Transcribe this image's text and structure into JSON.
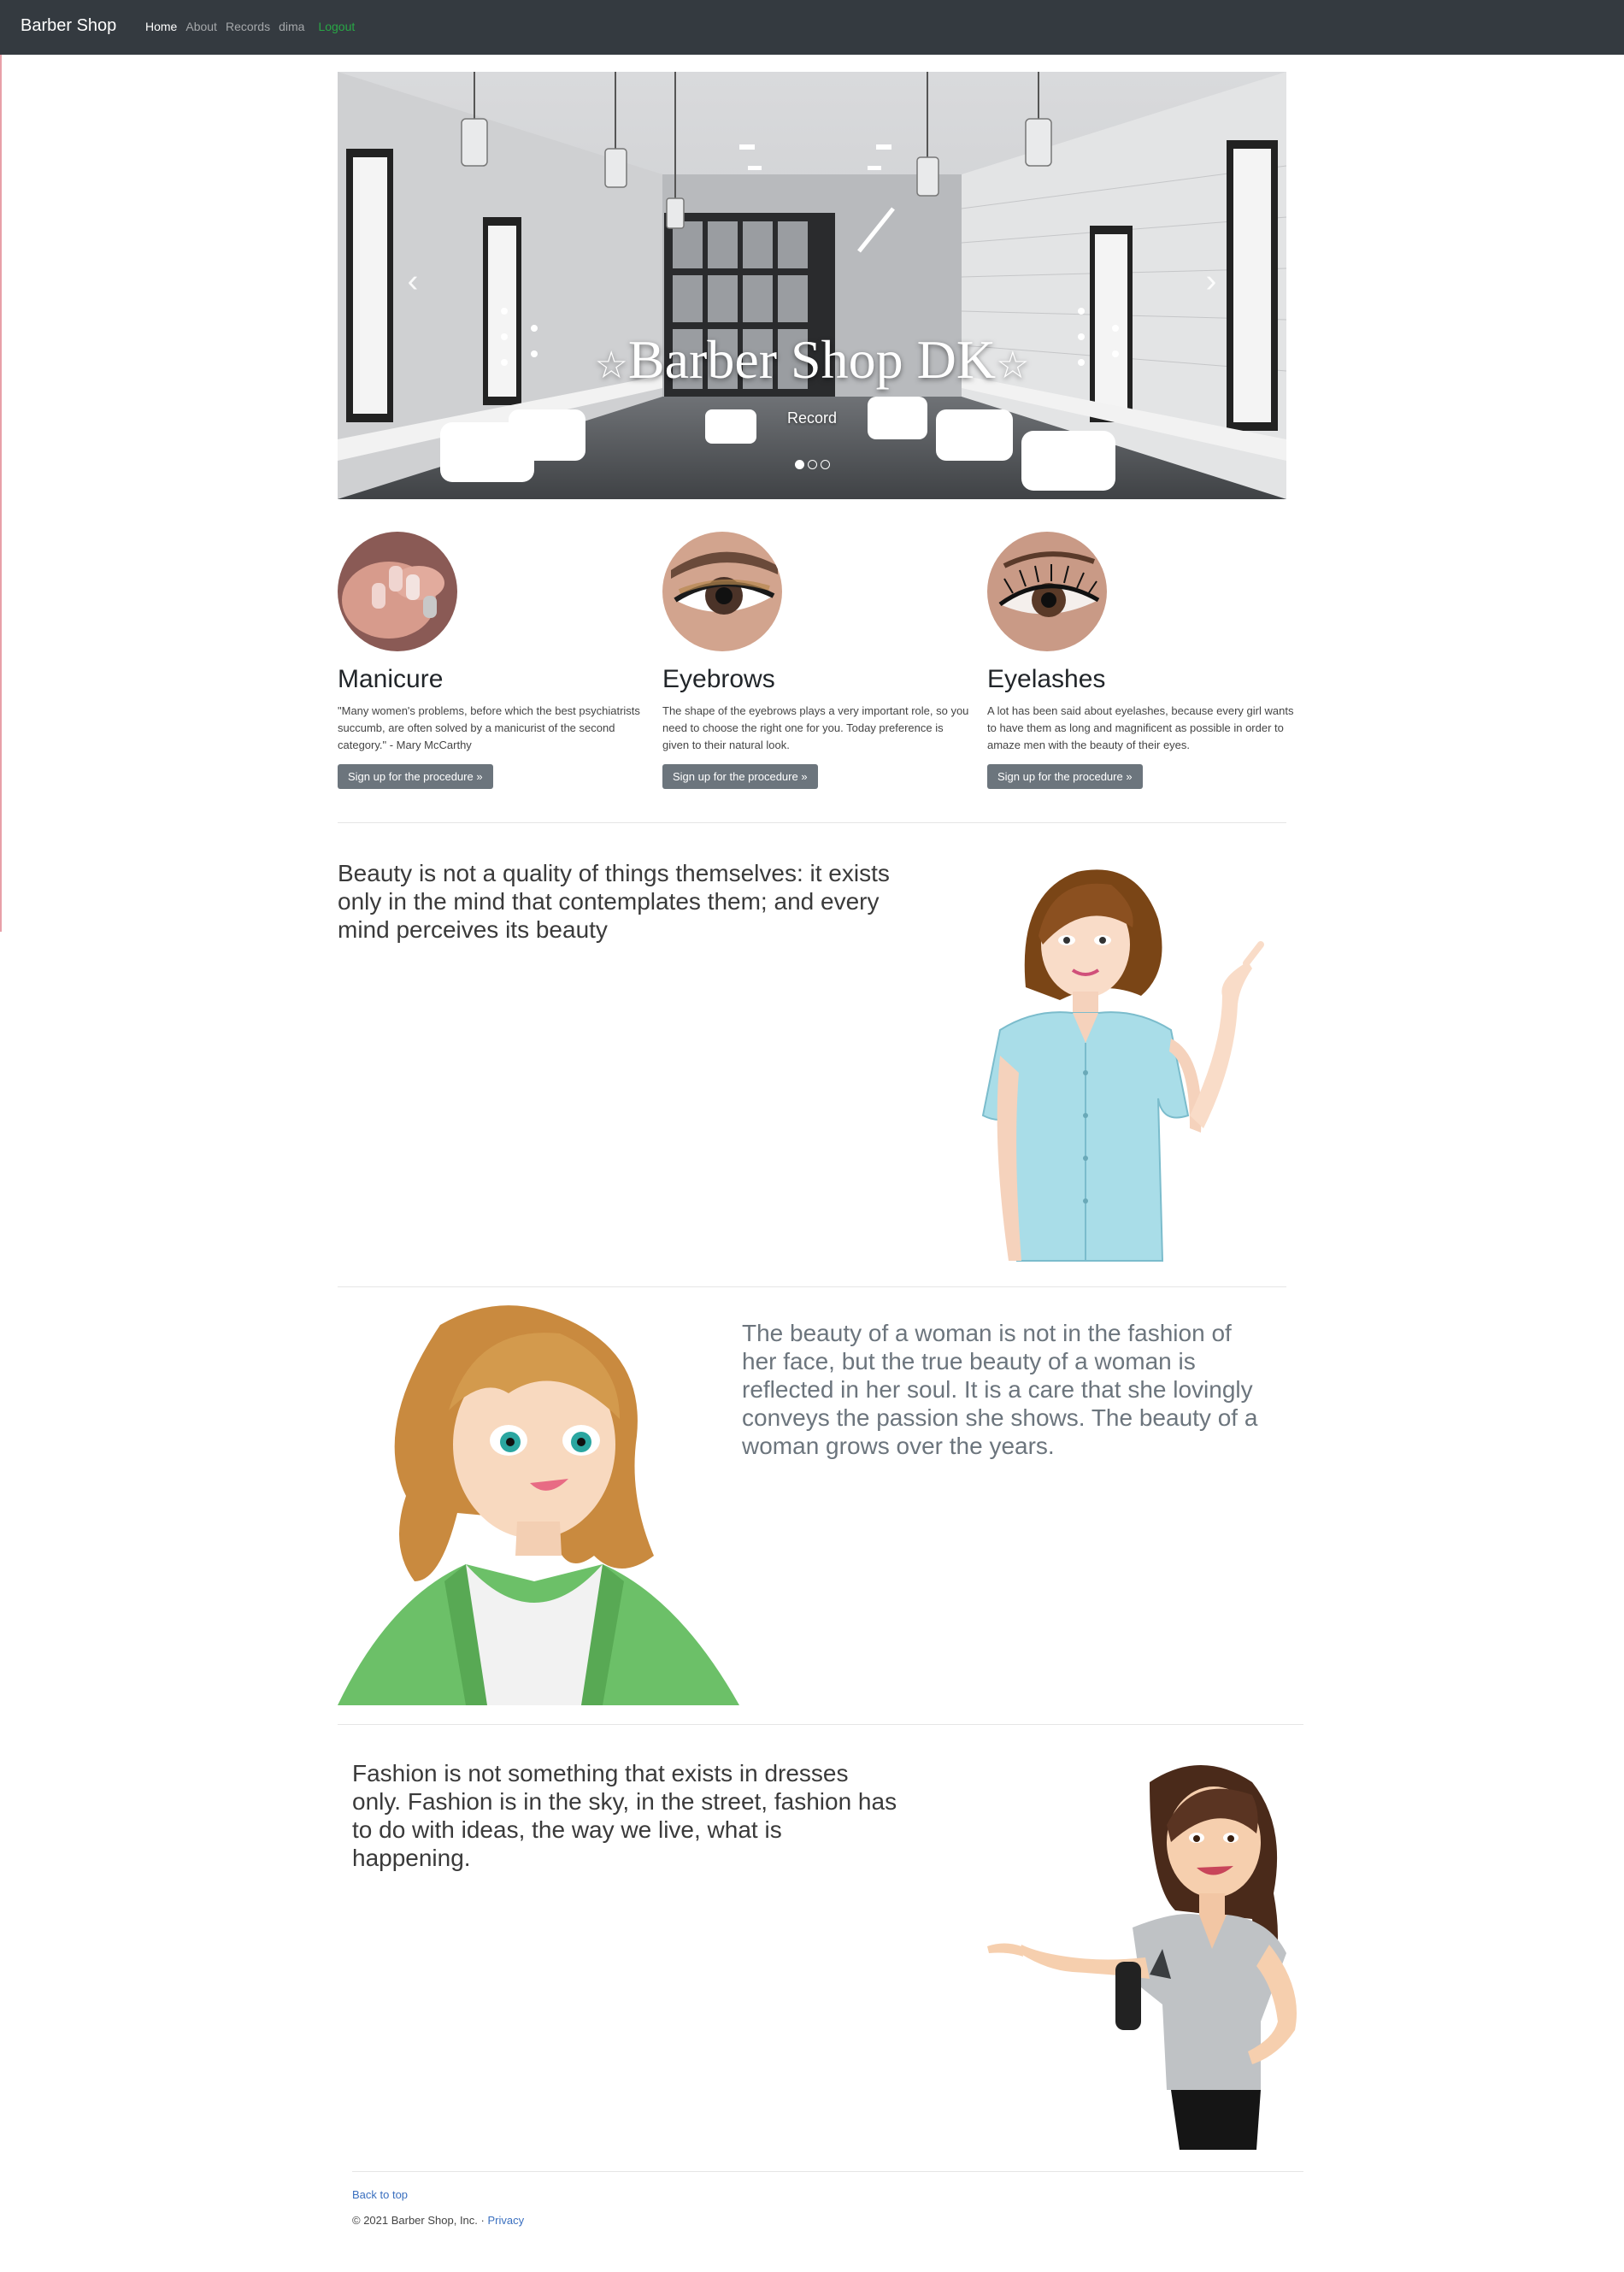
{
  "navbar": {
    "brand": "Barber Shop",
    "links": [
      "Home",
      "About",
      "Records",
      "dima"
    ],
    "logout": "Logout"
  },
  "carousel": {
    "title": "Barber Shop DK",
    "star": "☆",
    "record": "Record",
    "prev_icon": "chevron-left-icon",
    "next_icon": "chevron-right-icon",
    "slides": 3,
    "active_slide": 1
  },
  "services": [
    {
      "title": "Manicure",
      "text": "\"Many women's problems, before which the best psychiatrists succumb, are often solved by a manicurist of the second category.\" - Mary McCarthy",
      "button": "Sign up for the procedure »"
    },
    {
      "title": "Eyebrows",
      "text": "The shape of the eyebrows plays a very important role, so you need to choose the right one for you. Today preference is given to their natural look.",
      "button": "Sign up for the procedure »"
    },
    {
      "title": "Eyelashes",
      "text": "A lot has been said about eyelashes, because every girl wants to have them as long and magnificent as possible in order to amaze men with the beauty of their eyes.",
      "button": "Sign up for the procedure »"
    }
  ],
  "features": [
    {
      "text": "Beauty is not a quality of things themselves: it exists only in the mind that contemplates them; and every mind perceives its beauty"
    },
    {
      "text": "The beauty of a woman is not in the fashion of her face, but the true beauty of a woman is reflected in her soul. It is a care that she lovingly conveys the passion she shows. The beauty of a woman grows over the years."
    },
    {
      "text": "Fashion is not something that exists in dresses only. Fashion is in the sky, in the street, fashion has to do with ideas, the way we live, what is happening."
    }
  ],
  "footer": {
    "back_to_top": "Back to top",
    "copyright": "© 2021 Barber Shop, Inc. ·",
    "privacy": "Privacy"
  },
  "colors": {
    "navbar": "#343a40",
    "logout": "#28a745",
    "button": "#6c757d",
    "link": "#3a6fbf"
  }
}
